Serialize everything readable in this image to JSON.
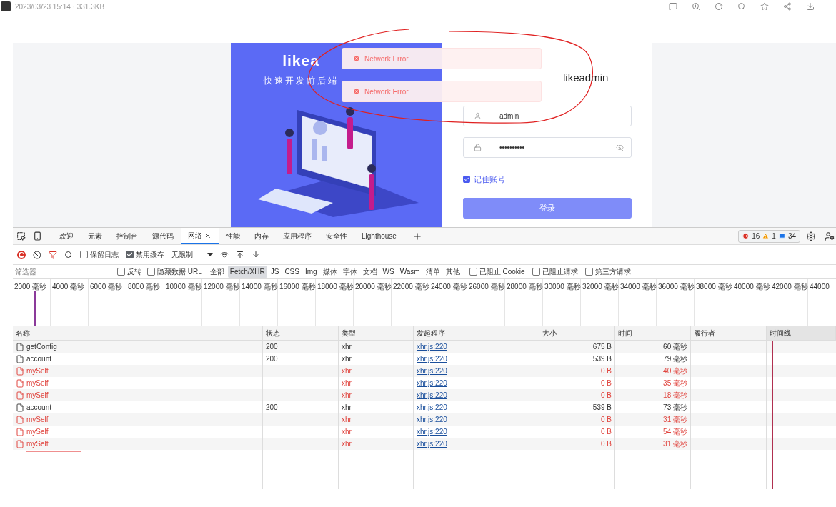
{
  "viewer": {
    "meta": "2023/03/23 15:14 · 331.3KB"
  },
  "login": {
    "logo": "likea",
    "slogan": "快速开发前后端",
    "title": "likeadmin",
    "username": "admin",
    "password": "••••••••••",
    "remember": {
      "label": "记住账号",
      "checked": true
    },
    "submit": "登录"
  },
  "toasts": [
    {
      "text": "Network Error"
    },
    {
      "text": "Network Error"
    }
  ],
  "devtools": {
    "tabs": [
      {
        "label": "欢迎",
        "selected": false
      },
      {
        "label": "元素",
        "selected": false
      },
      {
        "label": "控制台",
        "selected": false
      },
      {
        "label": "源代码",
        "selected": false
      },
      {
        "label": "网络",
        "selected": true,
        "closable": true
      },
      {
        "label": "性能",
        "selected": false
      },
      {
        "label": "内存",
        "selected": false
      },
      {
        "label": "应用程序",
        "selected": false
      },
      {
        "label": "安全性",
        "selected": false
      },
      {
        "label": "Lighthouse",
        "selected": false
      }
    ],
    "counts": {
      "errors": "16",
      "warnings": "1",
      "messages": "34"
    },
    "toolbar": {
      "preserve_log": {
        "label": "保留日志",
        "checked": false
      },
      "disable_cache": {
        "label": "禁用缓存",
        "checked": true
      },
      "throttle": "无限制"
    },
    "filter": {
      "placeholder": "筛选器",
      "options": [
        {
          "label": "反转",
          "checked": false
        },
        {
          "label": "隐藏数据 URL",
          "checked": false
        }
      ],
      "types": [
        {
          "label": "全部",
          "selected": false
        },
        {
          "label": "Fetch/XHR",
          "selected": true
        },
        {
          "label": "JS",
          "selected": false
        },
        {
          "label": "CSS",
          "selected": false
        },
        {
          "label": "Img",
          "selected": false
        },
        {
          "label": "媒体",
          "selected": false
        },
        {
          "label": "字体",
          "selected": false
        },
        {
          "label": "文档",
          "selected": false
        },
        {
          "label": "WS",
          "selected": false
        },
        {
          "label": "Wasm",
          "selected": false
        },
        {
          "label": "清单",
          "selected": false
        },
        {
          "label": "其他",
          "selected": false
        }
      ],
      "extra": [
        {
          "label": "已阻止 Cookie",
          "checked": false
        },
        {
          "label": "已阻止请求",
          "checked": false
        },
        {
          "label": "第三方请求",
          "checked": false
        }
      ]
    },
    "overview": {
      "ticks": [
        "2000 毫秒",
        "4000 毫秒",
        "6000 毫秒",
        "8000 毫秒",
        "10000 毫秒",
        "12000 毫秒",
        "14000 毫秒",
        "16000 毫秒",
        "18000 毫秒",
        "20000 毫秒",
        "22000 毫秒",
        "24000 毫秒",
        "26000 毫秒",
        "28000 毫秒",
        "30000 毫秒",
        "32000 毫秒",
        "34000 毫秒",
        "36000 毫秒",
        "38000 毫秒",
        "40000 毫秒",
        "42000 毫秒",
        "44000"
      ]
    },
    "table": {
      "columns": [
        "名称",
        "状态",
        "类型",
        "发起程序",
        "大小",
        "时间",
        "履行者",
        "时间线"
      ],
      "rows": [
        {
          "name": "getConfig",
          "status": "200",
          "type": "xhr",
          "initiator": "xhr.js:220",
          "size": "675 B",
          "time": "60 毫秒",
          "failed": false
        },
        {
          "name": "account",
          "status": "200",
          "type": "xhr",
          "initiator": "xhr.js:220",
          "size": "539 B",
          "time": "79 毫秒",
          "failed": false
        },
        {
          "name": "mySelf",
          "type": "xhr",
          "initiator": "xhr.js:220",
          "size": "0 B",
          "time": "40 毫秒",
          "failed": true
        },
        {
          "name": "mySelf",
          "type": "xhr",
          "initiator": "xhr.js:220",
          "size": "0 B",
          "time": "35 毫秒",
          "failed": true
        },
        {
          "name": "mySelf",
          "type": "xhr",
          "initiator": "xhr.js:220",
          "size": "0 B",
          "time": "18 毫秒",
          "failed": true
        },
        {
          "name": "account",
          "status": "200",
          "type": "xhr",
          "initiator": "xhr.js:220",
          "size": "539 B",
          "time": "73 毫秒",
          "failed": false
        },
        {
          "name": "mySelf",
          "type": "xhr",
          "initiator": "xhr.js:220",
          "size": "0 B",
          "time": "31 毫秒",
          "failed": true
        },
        {
          "name": "mySelf",
          "type": "xhr",
          "initiator": "xhr.js:220",
          "size": "0 B",
          "time": "54 毫秒",
          "failed": true
        },
        {
          "name": "mySelf",
          "type": "xhr",
          "initiator": "xhr.js:220",
          "size": "0 B",
          "time": "31 毫秒",
          "failed": true
        }
      ]
    }
  }
}
